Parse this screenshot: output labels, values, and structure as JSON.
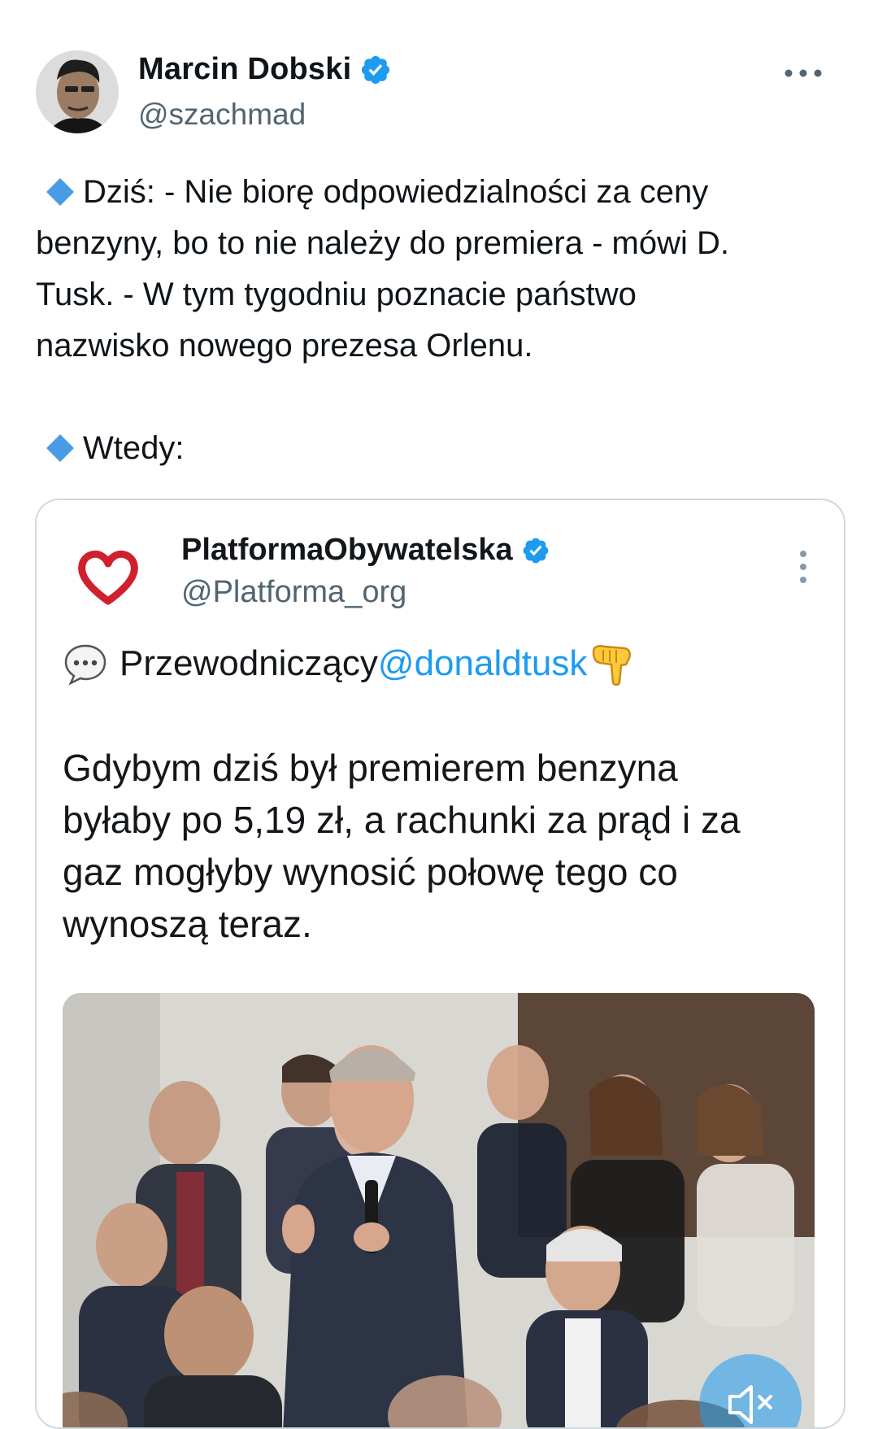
{
  "tweet": {
    "author": {
      "display_name": "Marcin Dobski",
      "handle": "@szachmad",
      "verified": true,
      "avatar_icon": "user-avatar-icon"
    },
    "more_icon": "more-horizontal-icon",
    "text_lines": [
      "Dziś: - Nie biorę odpowiedzialności za ceny",
      "benzyny, bo to nie należy do premiera - mówi D.",
      "Tusk. - W tym tygodniu poznacie państwo",
      "nazwisko nowego prezesa Orlenu.",
      "Wtedy:"
    ],
    "bullet_icon": "blue-diamond-icon",
    "bullet_color": "#4a9be6"
  },
  "quoted": {
    "author": {
      "display_name": "PlatformaObywatelska",
      "handle": "@Platforma_org",
      "verified": true,
      "logo_icon": "heart-logo-icon",
      "logo_color": "#d0202e"
    },
    "menu_icon": "more-vertical-icon",
    "intro": {
      "icon": "speech-bubble-icon",
      "text": "Przewodniczący ",
      "mention": "@donaldtusk",
      "emoji": "pointing-down-hand-icon"
    },
    "body_lines": [
      "Gdybym dziś był premierem benzyna",
      "byłaby po 5,19 zł, a rachunki za prąd i za",
      "gaz mogłyby wynosić połowę tego co",
      "wynoszą teraz."
    ],
    "media": {
      "type": "photo",
      "mute_icon": "speaker-muted-icon"
    }
  },
  "colors": {
    "text_primary": "#0f1419",
    "text_secondary": "#536471",
    "link": "#1d9bf0",
    "verified_badge": "#1d9bf0",
    "card_border": "#cfd9de"
  }
}
